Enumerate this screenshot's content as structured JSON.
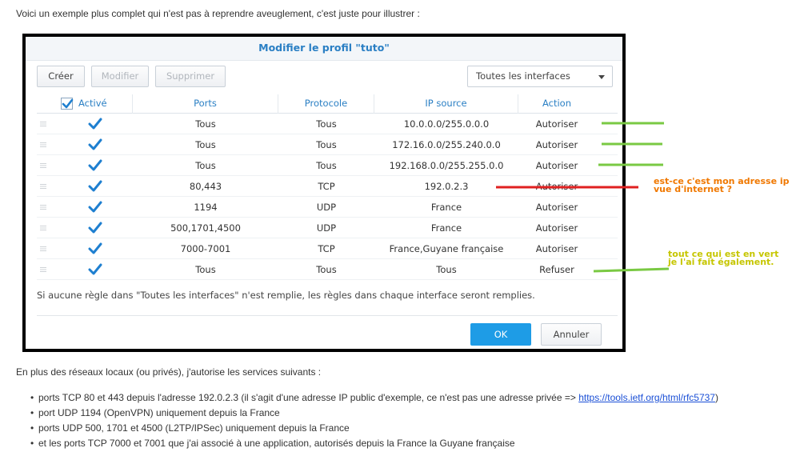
{
  "intro_text": "Voici un exemple plus complet qui n'est pas à reprendre aveuglement, c'est juste pour illustrer :",
  "dialog": {
    "title": "Modifier le profil \"tuto\"",
    "toolbar": {
      "create_label": "Créer",
      "edit_label": "Modifier",
      "delete_label": "Supprimer",
      "interface_select_value": "Toutes les interfaces"
    },
    "columns": [
      "Activé",
      "Ports",
      "Protocole",
      "IP source",
      "Action"
    ],
    "rows": [
      {
        "enabled": true,
        "ports": "Tous",
        "protocol": "Tous",
        "source": "10.0.0.0/255.0.0.0",
        "action": "Autoriser"
      },
      {
        "enabled": true,
        "ports": "Tous",
        "protocol": "Tous",
        "source": "172.16.0.0/255.240.0.0",
        "action": "Autoriser"
      },
      {
        "enabled": true,
        "ports": "Tous",
        "protocol": "Tous",
        "source": "192.168.0.0/255.255.0.0",
        "action": "Autoriser"
      },
      {
        "enabled": true,
        "ports": "80,443",
        "protocol": "TCP",
        "source": "192.0.2.3",
        "action": "Autoriser"
      },
      {
        "enabled": true,
        "ports": "1194",
        "protocol": "UDP",
        "source": "France",
        "action": "Autoriser"
      },
      {
        "enabled": true,
        "ports": "500,1701,4500",
        "protocol": "UDP",
        "source": "France",
        "action": "Autoriser"
      },
      {
        "enabled": true,
        "ports": "7000-7001",
        "protocol": "TCP",
        "source": "France,Guyane française",
        "action": "Autoriser"
      },
      {
        "enabled": true,
        "ports": "Tous",
        "protocol": "Tous",
        "source": "Tous",
        "action": "Refuser"
      }
    ],
    "note": "Si aucune règle dans \"Toutes les interfaces\" n'est remplie, les règles dans chaque interface seront remplies.",
    "ok_label": "OK",
    "cancel_label": "Annuler"
  },
  "annotations": {
    "question_line1": "est-ce c'est mon adresse ip",
    "question_line2": "vue d'internet ?",
    "green_line1": "tout ce qui est en vert",
    "green_line2": "je l'ai fait également."
  },
  "paragraph": "En plus des réseaux locaux (ou privés), j'autorise les services suivants :",
  "list": [
    {
      "text": "ports TCP 80 et 443 depuis l'adresse 192.0.2.3 (il s'agit d'une adresse IP public d'exemple, ce n'est pas une adresse privée => ",
      "link": "https://tools.ietf.org/html/rfc5737",
      "after": ")"
    },
    {
      "text": "port UDP 1194 (OpenVPN) uniquement depuis la France"
    },
    {
      "text": "ports UDP 500, 1701 et 4500 (L2TP/IPSec) uniquement depuis la France"
    },
    {
      "text": "et les ports TCP 7000 et 7001 que j'ai associé à une application, autorisés depuis la France la Guyane française"
    }
  ],
  "colors": {
    "accent_blue": "#2a7fc4",
    "ok_blue": "#1e9ce6",
    "annotation_green": "#7ac943",
    "annotation_red": "#e02020",
    "annotation_orange": "#f07800",
    "annotation_yellow": "#c6c600"
  },
  "icons": [
    "checkmark-icon",
    "drag-handle-icon",
    "chevron-down-icon"
  ]
}
